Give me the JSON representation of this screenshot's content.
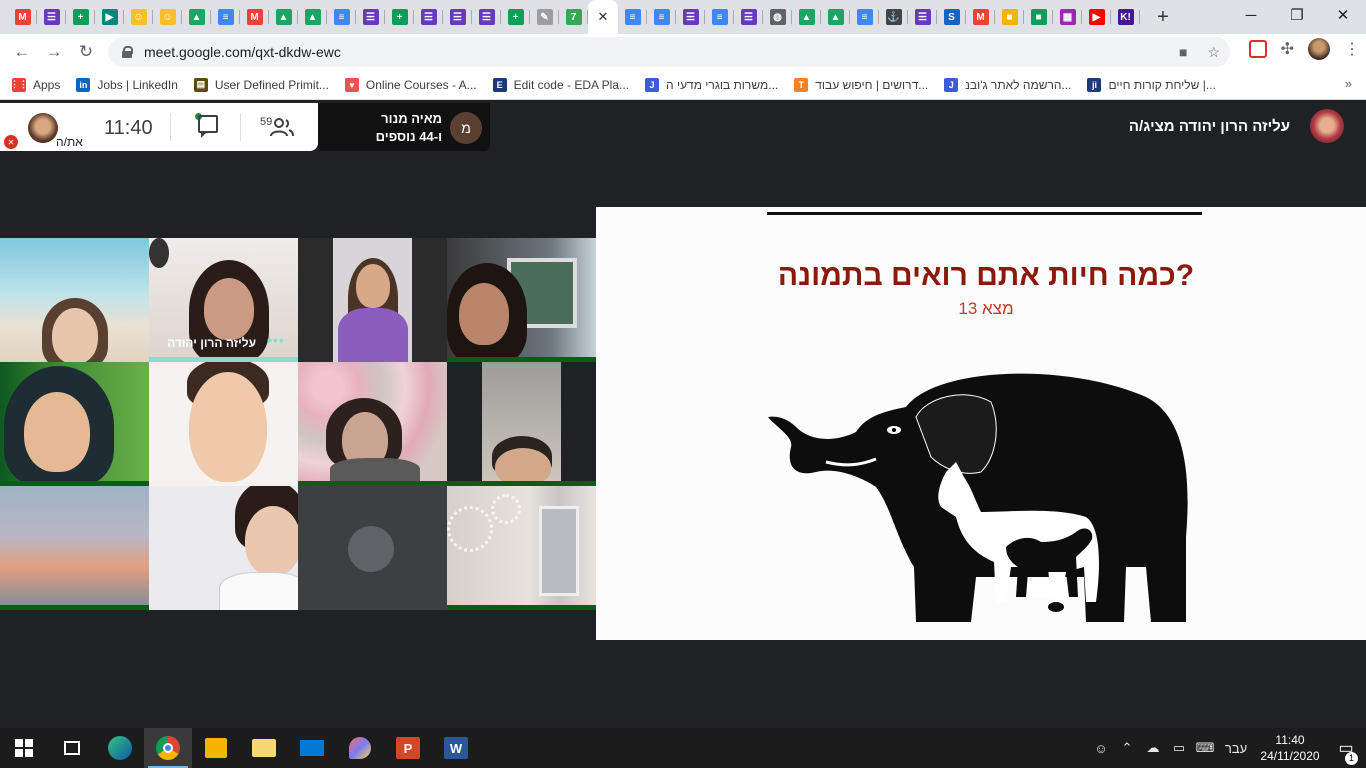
{
  "browser": {
    "tabs": [
      {
        "icon": "gmail-icon",
        "color": "#ea4335",
        "glyph": "M"
      },
      {
        "icon": "forms-icon",
        "color": "#673ab7",
        "glyph": "☰"
      },
      {
        "icon": "sheets-icon",
        "color": "#0f9d58",
        "glyph": "+"
      },
      {
        "icon": "meet-icon",
        "color": "#00897b",
        "glyph": "▶"
      },
      {
        "icon": "emoji-icon",
        "color": "#f6c026",
        "glyph": "☺"
      },
      {
        "icon": "emoji-icon",
        "color": "#f6c026",
        "glyph": "☺"
      },
      {
        "icon": "drive-icon",
        "color": "#1fa463",
        "glyph": "▲"
      },
      {
        "icon": "docs-icon",
        "color": "#4285f4",
        "glyph": "≡"
      },
      {
        "icon": "gmail-icon",
        "color": "#ea4335",
        "glyph": "M"
      },
      {
        "icon": "drive-icon",
        "color": "#1fa463",
        "glyph": "▲"
      },
      {
        "icon": "drive-icon",
        "color": "#1fa463",
        "glyph": "▲"
      },
      {
        "icon": "docs-icon",
        "color": "#4285f4",
        "glyph": "≡"
      },
      {
        "icon": "forms-icon",
        "color": "#673ab7",
        "glyph": "☰"
      },
      {
        "icon": "sheets-icon",
        "color": "#0f9d58",
        "glyph": "+"
      },
      {
        "icon": "forms-icon",
        "color": "#673ab7",
        "glyph": "☰"
      },
      {
        "icon": "forms-icon",
        "color": "#673ab7",
        "glyph": "☰"
      },
      {
        "icon": "forms-icon",
        "color": "#673ab7",
        "glyph": "☰"
      },
      {
        "icon": "sheets-icon",
        "color": "#0f9d58",
        "glyph": "+"
      },
      {
        "icon": "pencil-icon",
        "color": "#9e9e9e",
        "glyph": "✎"
      },
      {
        "icon": "app-icon",
        "color": "#34a853",
        "glyph": "7"
      }
    ],
    "active_tab_close": "✕",
    "tabs_after": [
      {
        "icon": "docs-icon",
        "color": "#4285f4",
        "glyph": "≡"
      },
      {
        "icon": "docs-icon",
        "color": "#4285f4",
        "glyph": "≡"
      },
      {
        "icon": "forms-icon",
        "color": "#673ab7",
        "glyph": "☰"
      },
      {
        "icon": "docs-icon",
        "color": "#4285f4",
        "glyph": "≡"
      },
      {
        "icon": "forms-icon",
        "color": "#673ab7",
        "glyph": "☰"
      },
      {
        "icon": "globe-icon",
        "color": "#5f6368",
        "glyph": "◍"
      },
      {
        "icon": "drive-icon",
        "color": "#1fa463",
        "glyph": "▲"
      },
      {
        "icon": "drive-icon",
        "color": "#1fa463",
        "glyph": "▲"
      },
      {
        "icon": "docs-icon",
        "color": "#4285f4",
        "glyph": "≡"
      },
      {
        "icon": "anchor-icon",
        "color": "#444",
        "glyph": "⚓"
      },
      {
        "icon": "forms-icon",
        "color": "#673ab7",
        "glyph": "☰"
      },
      {
        "icon": "s-icon",
        "color": "#1565c0",
        "glyph": "S"
      },
      {
        "icon": "gmail-icon",
        "color": "#ea4335",
        "glyph": "M"
      },
      {
        "icon": "classroom-icon",
        "color": "#f4b400",
        "glyph": "■"
      },
      {
        "icon": "classroom-icon",
        "color": "#0f9d58",
        "glyph": "■"
      },
      {
        "icon": "color-icon",
        "color": "#9c27b0",
        "glyph": "▦"
      },
      {
        "icon": "youtube-icon",
        "color": "#ff0000",
        "glyph": "▶"
      },
      {
        "icon": "kahoot-icon",
        "color": "#46178f",
        "glyph": "K!"
      }
    ],
    "new_tab": "+",
    "url": "meet.google.com/qxt-dkdw-ewc",
    "bookmarks": [
      {
        "label": "Apps",
        "icon": "apps-grid-icon",
        "color": "#ea4335",
        "glyph": "⋮⋮"
      },
      {
        "label": "Jobs | LinkedIn",
        "icon": "linkedin-icon",
        "color": "#0a66c2",
        "glyph": "in"
      },
      {
        "label": "User Defined Primit...",
        "icon": "chip-icon",
        "color": "#5d4b0c",
        "glyph": "▤"
      },
      {
        "label": "Online Courses - A...",
        "icon": "udemy-icon",
        "color": "#ec5252",
        "glyph": "♥"
      },
      {
        "label": "Edit code - EDA Pla...",
        "icon": "eda-icon",
        "color": "#1a3a7a",
        "glyph": "E"
      },
      {
        "label": "משרות בוגרי מדעי ה...",
        "icon": "jobs-icon",
        "color": "#3b5bdb",
        "glyph": "J"
      },
      {
        "label": "דרושים | חיפוש עבוד...",
        "icon": "jobs-icon",
        "color": "#f0822b",
        "glyph": "T"
      },
      {
        "label": "הרשמה לאתר ג'ובנ...",
        "icon": "jobs-icon",
        "color": "#3b5bdb",
        "glyph": "J"
      },
      {
        "label": "שליחת קורות חיים |...",
        "icon": "jobs-icon",
        "color": "#1a3a7a",
        "glyph": "ji"
      }
    ],
    "bookmarks_more": "»"
  },
  "meet": {
    "self_label": "את/ה",
    "time": "11:40",
    "participants_count": "59",
    "pill_avatar_letter": "מ",
    "pill_name": "מאיה מנור",
    "pill_more": "ו-44 נוספים",
    "presenting_label": "עליזה הרון יהודה מציג/ה",
    "tile_name": "עליזה הרון יהודה",
    "tile_dots": "•••"
  },
  "slide": {
    "title": "כמה חיות אתם רואים בתמונה?",
    "subtitle": "מצא 13"
  },
  "taskbar": {
    "language": "עבר",
    "time": "11:40",
    "date": "24/11/2020",
    "notifications": "1"
  },
  "colors": {
    "meet_bg": "#202124",
    "slide_title": "#8a1a0c",
    "active_speaker": "#7fe3cb",
    "tile_bar": "#0b5c1a"
  }
}
